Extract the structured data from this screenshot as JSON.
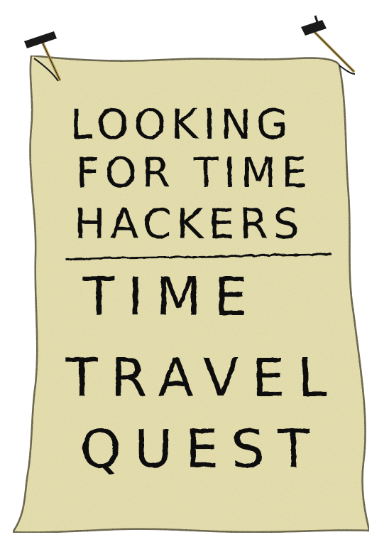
{
  "poster": {
    "line1": "LOOKING",
    "line2": "FOR TIME",
    "line3": "HACKERS",
    "line4": "TIME",
    "line5": "TRAVEL",
    "line6": "QUEST"
  },
  "colors": {
    "paper": "#ece6b6",
    "paper_shade": "#ddd49e",
    "ink": "#111111",
    "nail_head": "#1a1a1a",
    "nail_shaft": "#b59a52"
  },
  "icons": {
    "left_pin": "nail-icon",
    "right_pin": "nail-icon"
  }
}
